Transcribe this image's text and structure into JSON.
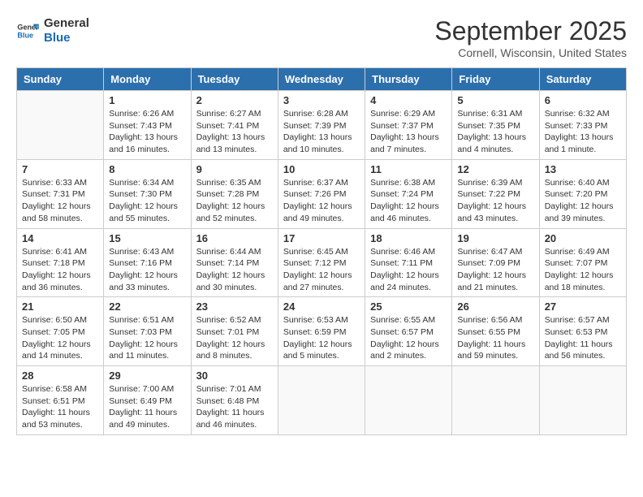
{
  "logo": {
    "line1": "General",
    "line2": "Blue"
  },
  "title": "September 2025",
  "location": "Cornell, Wisconsin, United States",
  "weekdays": [
    "Sunday",
    "Monday",
    "Tuesday",
    "Wednesday",
    "Thursday",
    "Friday",
    "Saturday"
  ],
  "weeks": [
    [
      {
        "day": null,
        "sunrise": null,
        "sunset": null,
        "daylight": null
      },
      {
        "day": "1",
        "sunrise": "Sunrise: 6:26 AM",
        "sunset": "Sunset: 7:43 PM",
        "daylight": "Daylight: 13 hours and 16 minutes."
      },
      {
        "day": "2",
        "sunrise": "Sunrise: 6:27 AM",
        "sunset": "Sunset: 7:41 PM",
        "daylight": "Daylight: 13 hours and 13 minutes."
      },
      {
        "day": "3",
        "sunrise": "Sunrise: 6:28 AM",
        "sunset": "Sunset: 7:39 PM",
        "daylight": "Daylight: 13 hours and 10 minutes."
      },
      {
        "day": "4",
        "sunrise": "Sunrise: 6:29 AM",
        "sunset": "Sunset: 7:37 PM",
        "daylight": "Daylight: 13 hours and 7 minutes."
      },
      {
        "day": "5",
        "sunrise": "Sunrise: 6:31 AM",
        "sunset": "Sunset: 7:35 PM",
        "daylight": "Daylight: 13 hours and 4 minutes."
      },
      {
        "day": "6",
        "sunrise": "Sunrise: 6:32 AM",
        "sunset": "Sunset: 7:33 PM",
        "daylight": "Daylight: 13 hours and 1 minute."
      }
    ],
    [
      {
        "day": "7",
        "sunrise": "Sunrise: 6:33 AM",
        "sunset": "Sunset: 7:31 PM",
        "daylight": "Daylight: 12 hours and 58 minutes."
      },
      {
        "day": "8",
        "sunrise": "Sunrise: 6:34 AM",
        "sunset": "Sunset: 7:30 PM",
        "daylight": "Daylight: 12 hours and 55 minutes."
      },
      {
        "day": "9",
        "sunrise": "Sunrise: 6:35 AM",
        "sunset": "Sunset: 7:28 PM",
        "daylight": "Daylight: 12 hours and 52 minutes."
      },
      {
        "day": "10",
        "sunrise": "Sunrise: 6:37 AM",
        "sunset": "Sunset: 7:26 PM",
        "daylight": "Daylight: 12 hours and 49 minutes."
      },
      {
        "day": "11",
        "sunrise": "Sunrise: 6:38 AM",
        "sunset": "Sunset: 7:24 PM",
        "daylight": "Daylight: 12 hours and 46 minutes."
      },
      {
        "day": "12",
        "sunrise": "Sunrise: 6:39 AM",
        "sunset": "Sunset: 7:22 PM",
        "daylight": "Daylight: 12 hours and 43 minutes."
      },
      {
        "day": "13",
        "sunrise": "Sunrise: 6:40 AM",
        "sunset": "Sunset: 7:20 PM",
        "daylight": "Daylight: 12 hours and 39 minutes."
      }
    ],
    [
      {
        "day": "14",
        "sunrise": "Sunrise: 6:41 AM",
        "sunset": "Sunset: 7:18 PM",
        "daylight": "Daylight: 12 hours and 36 minutes."
      },
      {
        "day": "15",
        "sunrise": "Sunrise: 6:43 AM",
        "sunset": "Sunset: 7:16 PM",
        "daylight": "Daylight: 12 hours and 33 minutes."
      },
      {
        "day": "16",
        "sunrise": "Sunrise: 6:44 AM",
        "sunset": "Sunset: 7:14 PM",
        "daylight": "Daylight: 12 hours and 30 minutes."
      },
      {
        "day": "17",
        "sunrise": "Sunrise: 6:45 AM",
        "sunset": "Sunset: 7:12 PM",
        "daylight": "Daylight: 12 hours and 27 minutes."
      },
      {
        "day": "18",
        "sunrise": "Sunrise: 6:46 AM",
        "sunset": "Sunset: 7:11 PM",
        "daylight": "Daylight: 12 hours and 24 minutes."
      },
      {
        "day": "19",
        "sunrise": "Sunrise: 6:47 AM",
        "sunset": "Sunset: 7:09 PM",
        "daylight": "Daylight: 12 hours and 21 minutes."
      },
      {
        "day": "20",
        "sunrise": "Sunrise: 6:49 AM",
        "sunset": "Sunset: 7:07 PM",
        "daylight": "Daylight: 12 hours and 18 minutes."
      }
    ],
    [
      {
        "day": "21",
        "sunrise": "Sunrise: 6:50 AM",
        "sunset": "Sunset: 7:05 PM",
        "daylight": "Daylight: 12 hours and 14 minutes."
      },
      {
        "day": "22",
        "sunrise": "Sunrise: 6:51 AM",
        "sunset": "Sunset: 7:03 PM",
        "daylight": "Daylight: 12 hours and 11 minutes."
      },
      {
        "day": "23",
        "sunrise": "Sunrise: 6:52 AM",
        "sunset": "Sunset: 7:01 PM",
        "daylight": "Daylight: 12 hours and 8 minutes."
      },
      {
        "day": "24",
        "sunrise": "Sunrise: 6:53 AM",
        "sunset": "Sunset: 6:59 PM",
        "daylight": "Daylight: 12 hours and 5 minutes."
      },
      {
        "day": "25",
        "sunrise": "Sunrise: 6:55 AM",
        "sunset": "Sunset: 6:57 PM",
        "daylight": "Daylight: 12 hours and 2 minutes."
      },
      {
        "day": "26",
        "sunrise": "Sunrise: 6:56 AM",
        "sunset": "Sunset: 6:55 PM",
        "daylight": "Daylight: 11 hours and 59 minutes."
      },
      {
        "day": "27",
        "sunrise": "Sunrise: 6:57 AM",
        "sunset": "Sunset: 6:53 PM",
        "daylight": "Daylight: 11 hours and 56 minutes."
      }
    ],
    [
      {
        "day": "28",
        "sunrise": "Sunrise: 6:58 AM",
        "sunset": "Sunset: 6:51 PM",
        "daylight": "Daylight: 11 hours and 53 minutes."
      },
      {
        "day": "29",
        "sunrise": "Sunrise: 7:00 AM",
        "sunset": "Sunset: 6:49 PM",
        "daylight": "Daylight: 11 hours and 49 minutes."
      },
      {
        "day": "30",
        "sunrise": "Sunrise: 7:01 AM",
        "sunset": "Sunset: 6:48 PM",
        "daylight": "Daylight: 11 hours and 46 minutes."
      },
      {
        "day": null,
        "sunrise": null,
        "sunset": null,
        "daylight": null
      },
      {
        "day": null,
        "sunrise": null,
        "sunset": null,
        "daylight": null
      },
      {
        "day": null,
        "sunrise": null,
        "sunset": null,
        "daylight": null
      },
      {
        "day": null,
        "sunrise": null,
        "sunset": null,
        "daylight": null
      }
    ]
  ]
}
